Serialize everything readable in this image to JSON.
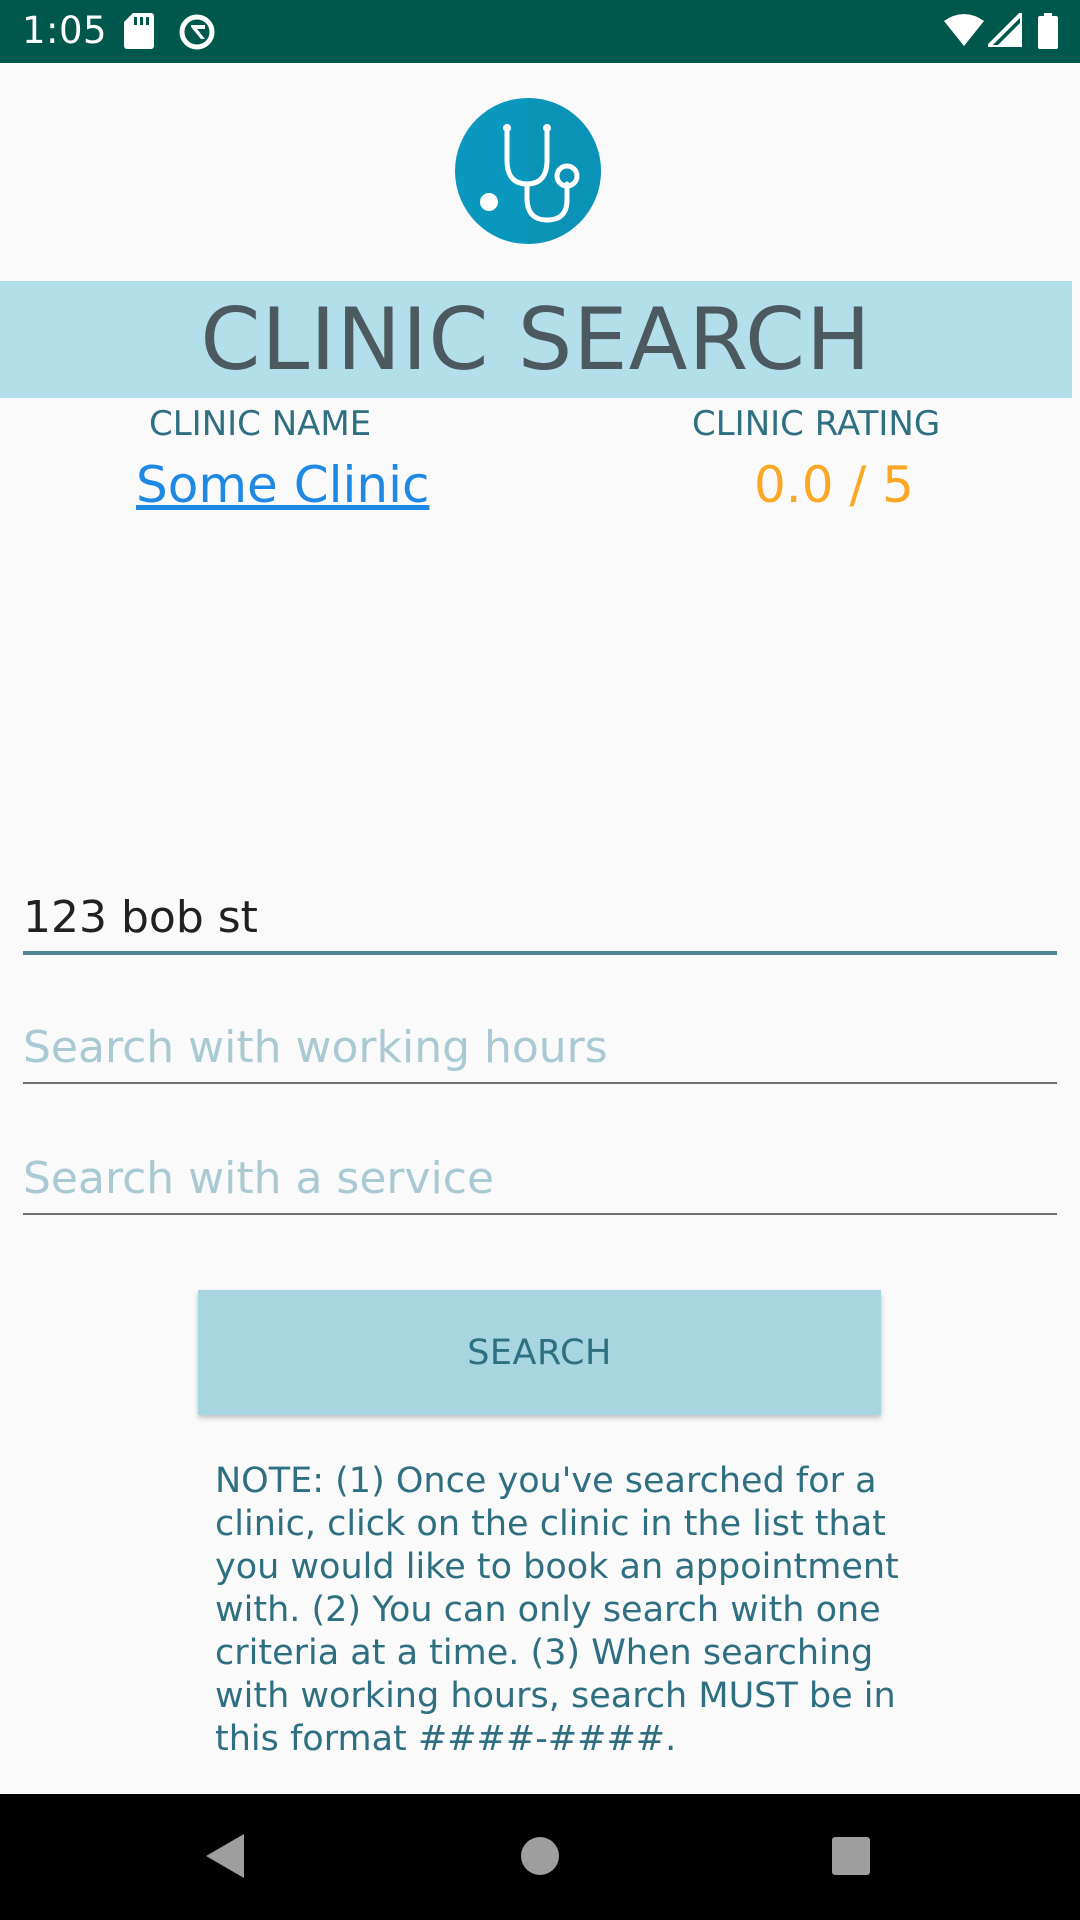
{
  "status_bar": {
    "time": "1:05",
    "left_icons": [
      "sd-card-icon",
      "data-saver-icon"
    ],
    "right_icons": [
      "wifi-icon",
      "cell-signal-icon",
      "battery-icon"
    ]
  },
  "logo": {
    "icon": "stethoscope-icon"
  },
  "title": "CLINIC SEARCH",
  "results": {
    "name_header": "CLINIC NAME",
    "rating_header": "CLINIC RATING",
    "clinic_name": "Some Clinic",
    "clinic_rating": "0.0 / 5"
  },
  "fields": {
    "address_value": "123 bob st",
    "hours_placeholder": "Search with working hours",
    "service_placeholder": "Search with a service"
  },
  "search_button": "SEARCH",
  "note": "NOTE: (1) Once you've searched for a clinic, click on the clinic in the list that you would like to book an appointment with. (2) You can only search with one criteria at a time. (3) When searching with working hours, search MUST be in this format ####-####.",
  "colors": {
    "status_bar": "#00574b",
    "banner": "#b2dfea",
    "button": "#a7d6e1",
    "accent_text": "#2f6f82",
    "link": "#1e88e5",
    "rating": "#f9a825"
  },
  "nav_bar": [
    "back-icon",
    "home-icon",
    "recents-icon"
  ]
}
